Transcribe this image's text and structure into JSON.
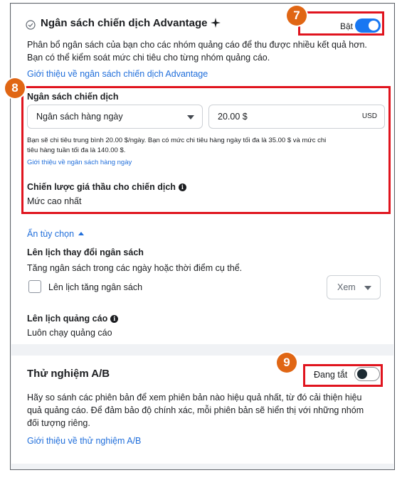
{
  "campaign_budget_section": {
    "title": "Ngân sách chiến dịch Advantage",
    "toggle_label": "Bật",
    "toggle_state": "on",
    "description_line1": "Phân bổ ngân sách của bạn cho các nhóm quảng cáo để thu được nhiều kết quả hơn.",
    "description_line2": "Bạn có thể kiểm soát mức chi tiêu cho từng nhóm quảng cáo.",
    "learn_more": "Giới thiệu về ngân sách chiến dịch Advantage"
  },
  "budget_block": {
    "heading": "Ngân sách chiến dịch",
    "budget_type": "Ngân sách hàng ngày",
    "amount": "20.00 $",
    "currency": "USD",
    "note_line1": "Bạn sẽ chi tiêu trung bình 20.00 $/ngày. Bạn có mức chi tiêu hàng ngày tối đa là 35.00 $ và mức chi",
    "note_line2": "tiêu hàng tuần tối đa là 140.00 $.",
    "daily_link": "Giới thiệu về ngân sách hàng ngày",
    "bid_strategy_heading": "Chiến lược giá thầu cho chiến dịch",
    "bid_strategy_value": "Mức cao nhất"
  },
  "options": {
    "hide_options": "Ẩn tùy chọn",
    "schedule_budget_heading": "Lên lịch thay đổi ngân sách",
    "schedule_budget_desc": "Tăng ngân sách trong các ngày hoặc thời điểm cụ thể.",
    "schedule_budget_checkbox": "Lên lịch tăng ngân sách",
    "view_button": "Xem",
    "ad_schedule_heading": "Lên lịch quảng cáo",
    "ad_schedule_value": "Luôn chạy quảng cáo"
  },
  "ab_test": {
    "title": "Thử nghiệm A/B",
    "toggle_label": "Đang tắt",
    "toggle_state": "off",
    "desc_line1": "Hãy so sánh các phiên bản để xem phiên bản nào hiệu quả nhất, từ đó cải thiện hiệu",
    "desc_line2": "quả quảng cáo. Để đảm bảo độ chính xác, mỗi phiên bản sẽ hiển thị với những nhóm",
    "desc_line3": "đối tượng riêng.",
    "learn_more": "Giới thiệu về thử nghiệm A/B"
  },
  "annotations": {
    "badge_7": "7",
    "badge_8": "8",
    "badge_9": "9",
    "highlight_color": "#e0141e",
    "badge_color": "#e06614"
  },
  "colors": {
    "accent": "#1877f2",
    "link": "#216fdb"
  }
}
